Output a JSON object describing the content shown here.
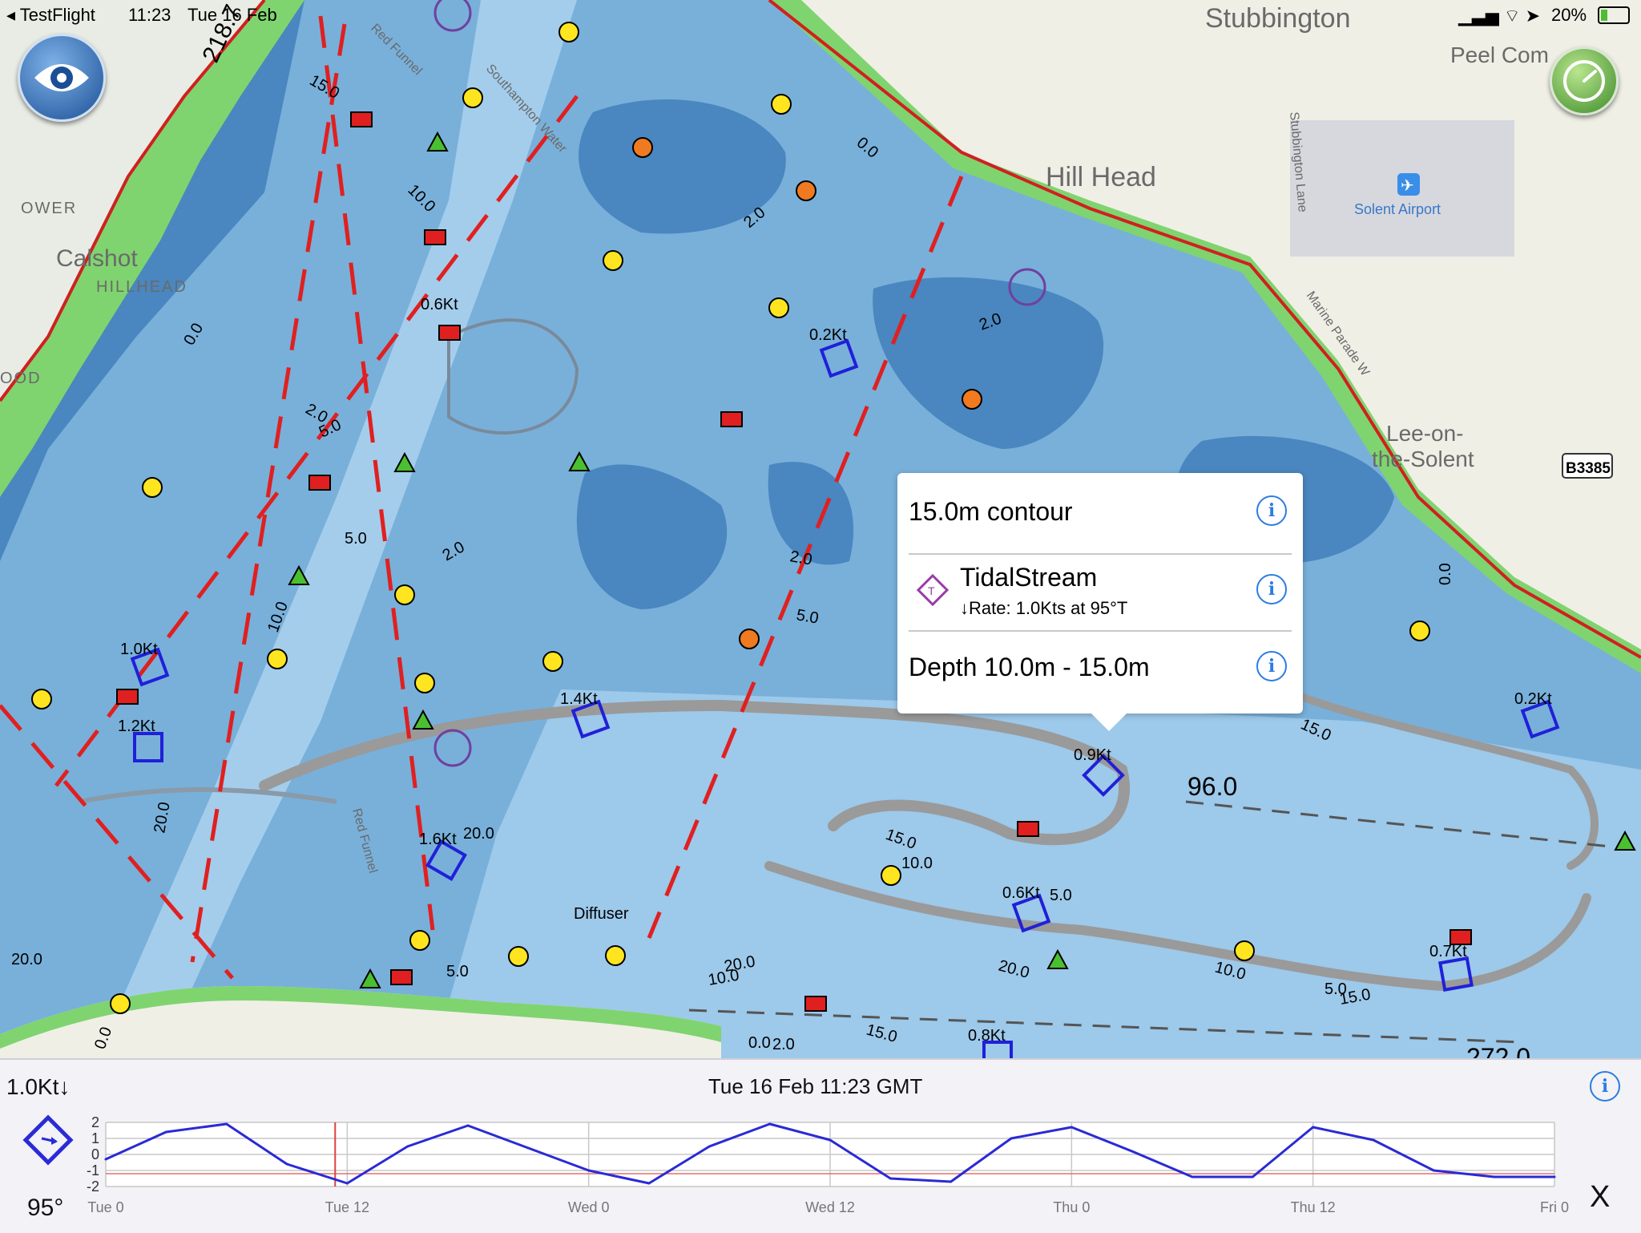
{
  "status_bar": {
    "back_app": "TestFlight",
    "time": "11:23",
    "date": "Tue 16 Feb",
    "battery": "20%"
  },
  "map": {
    "place_labels": [
      "Stubbington",
      "Peel Com",
      "Hill Head",
      "Solent Airport",
      "Calshot",
      "HILLHEAD",
      "OWER",
      "OOD",
      "Lee-on-",
      "the-Solent",
      "Diffuser",
      "Red Funnel",
      "Southampton Water",
      "Stubbington Lane",
      "Marine Parade W"
    ],
    "road_badge": "B3385",
    "tidal_labels": [
      "0.6Kt",
      "0.2Kt",
      "1.0Kt",
      "1.2Kt",
      "1.4Kt",
      "0.9Kt",
      "0.2Kt",
      "1.6Kt",
      "0.6Kt",
      "0.7Kt",
      "0.8Kt"
    ],
    "depth_labels": [
      "15.0",
      "10.0",
      "2.0",
      "5.0",
      "0.0",
      "2.0",
      "5.0",
      "2.0",
      "5.0",
      "20.0",
      "20.0",
      "20.0",
      "10.0",
      "15.0",
      "10.0",
      "5.0",
      "20.0",
      "10.0",
      "5.0",
      "15.0",
      "0.0",
      "2.0",
      "15.0",
      "2.0",
      "0.0",
      "218.7",
      "96.0",
      "272.0",
      "15.0",
      "10.0",
      "5.0",
      "0.0"
    ]
  },
  "popup": {
    "row1_title": "15.0m contour",
    "row2_title": "TidalStream",
    "row2_subtitle": "↓Rate: 1.0Kts at 95°T",
    "row3_title": "Depth 10.0m - 15.0m"
  },
  "tide_panel": {
    "rate": "1.0Kt↓",
    "timestamp": "Tue 16 Feb 11:23 GMT",
    "direction": "95°",
    "close_label": "X",
    "y_ticks": [
      "2",
      "1",
      "0",
      "-1",
      "-2"
    ],
    "x_ticks": [
      "Tue 0",
      "Tue 12",
      "Wed 0",
      "Wed 12",
      "Thu 0",
      "Thu 12",
      "Fri 0"
    ],
    "accent_color": "#2a2ad6"
  },
  "chart_data": {
    "type": "line",
    "title": "",
    "xlabel": "",
    "ylabel": "",
    "ylim": [
      -2,
      2
    ],
    "x_ticks": [
      "Tue 0",
      "Tue 12",
      "Wed 0",
      "Wed 12",
      "Thu 0",
      "Thu 12",
      "Fri 0"
    ],
    "series": [
      {
        "x": [
          0,
          3,
          6,
          9,
          12,
          15,
          18,
          21,
          24,
          27,
          30,
          33,
          36,
          39,
          42,
          45,
          48,
          51,
          54,
          57,
          60,
          63,
          66,
          69,
          72
        ],
        "values": [
          -0.3,
          1.4,
          1.9,
          -0.6,
          -1.8,
          0.5,
          1.8,
          0.4,
          -1.0,
          -1.8,
          0.5,
          1.9,
          0.9,
          -1.5,
          -1.7,
          1.0,
          1.7,
          0.2,
          -1.4,
          -1.4,
          1.7,
          0.9,
          -1.0,
          -1.4,
          -1.4
        ]
      }
    ],
    "now_marker_x": 11.4,
    "reference_lines": [
      -1.2
    ]
  }
}
